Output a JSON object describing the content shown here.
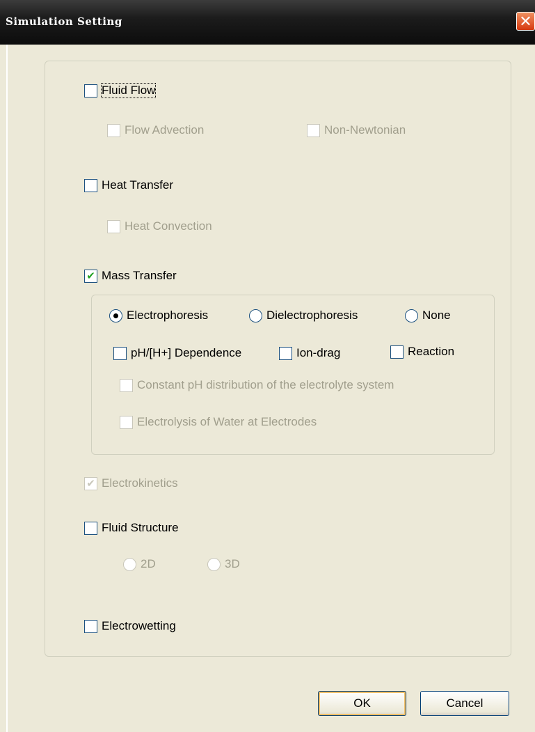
{
  "window": {
    "title": "Simulation Setting"
  },
  "fluid_flow": {
    "label": "Fluid Flow",
    "checked": false,
    "flow_advection": "Flow Advection",
    "non_newtonian": "Non-Newtonian"
  },
  "heat_transfer": {
    "label": "Heat Transfer",
    "checked": false,
    "heat_convection": "Heat Convection"
  },
  "mass_transfer": {
    "label": "Mass Transfer",
    "checked": true,
    "mode_options": [
      "Electrophoresis",
      "Dielectrophoresis",
      "None"
    ],
    "selected_mode": "Electrophoresis",
    "ph_dependence": "pH/[H+] Dependence",
    "ion_drag": "Ion-drag",
    "reaction": "Reaction",
    "constant_ph": "Constant pH distribution of the electrolyte system",
    "electrolysis": "Electrolysis of Water at Electrodes"
  },
  "electrokinetics": {
    "label": "Electrokinetics",
    "checked": true
  },
  "fluid_structure": {
    "label": "Fluid Structure",
    "checked": false,
    "dims": [
      "2D",
      "3D"
    ]
  },
  "electrowetting": {
    "label": "Electrowetting",
    "checked": false
  },
  "buttons": {
    "ok": "OK",
    "cancel": "Cancel"
  },
  "colors": {
    "title_bar": "#1c1c1c",
    "dialog_bg": "#ece9d8",
    "close_button": "#e0501c",
    "check_mark": "#21a121"
  }
}
